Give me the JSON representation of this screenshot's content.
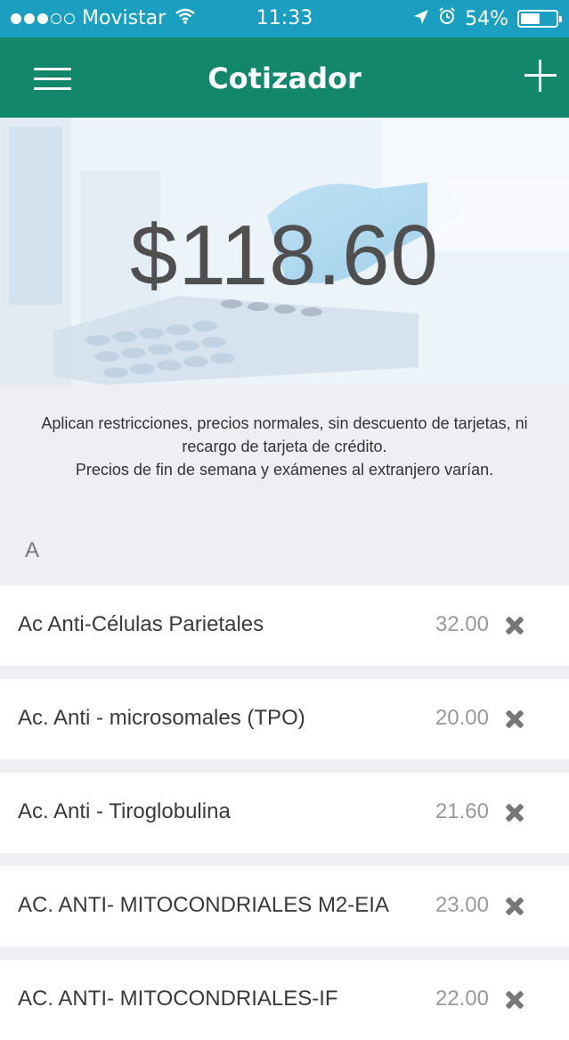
{
  "status_bar": {
    "carrier": "Movistar",
    "signal_bars": 5,
    "signal_filled": 3,
    "time": "11:33",
    "battery": "54%",
    "battery_level": 0.54,
    "icons": [
      "wifi-icon",
      "location-arrow-icon",
      "alarm-icon",
      "battery-icon"
    ]
  },
  "navbar": {
    "title": "Cotizador",
    "left_icon": "menu-icon",
    "right_icon": "plus-icon"
  },
  "hero": {
    "total": "$118.60"
  },
  "disclaimer": {
    "line1": "Aplican restricciones, precios normales, sin descuento de tarjetas, ni",
    "line2": "recargo de tarjeta de crédito.",
    "line3": "Precios de fin de semana y exámenes al extranjero varían."
  },
  "section": {
    "letter": "A"
  },
  "items": [
    {
      "name": "Ac Anti-Células Parietales",
      "price": "32.00"
    },
    {
      "name": "Ac. Anti - microsomales (TPO)",
      "price": "20.00"
    },
    {
      "name": "Ac. Anti - Tiroglobulina",
      "price": "21.60"
    },
    {
      "name": "AC. ANTI- MITOCONDRIALES M2-EIA",
      "price": "23.00"
    },
    {
      "name": "AC. ANTI- MITOCONDRIALES-IF",
      "price": "22.00"
    }
  ],
  "colors": {
    "status_bar": "#1a9fc0",
    "navbar": "#12876b",
    "background": "#efeef3"
  }
}
